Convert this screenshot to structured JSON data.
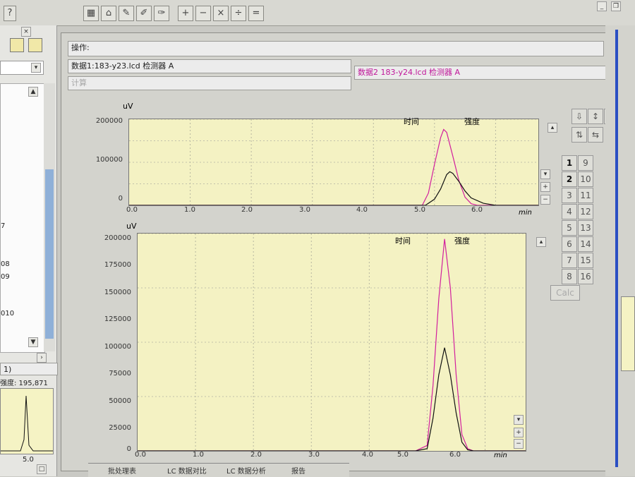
{
  "toolbar": {
    "help_icon": "?"
  },
  "left_panel": {
    "list_items": [
      "7",
      "08",
      "09",
      "010"
    ],
    "dropdown": "1)",
    "intensity": "强度: 195,871",
    "thumb_x_tick": "5.0"
  },
  "fields": {
    "operation": "操作:",
    "data1": "数据1:183-y23.lcd 检测器 A",
    "data2": "数据2 183-y24.lcd 检测器 A",
    "calc": "计算"
  },
  "plot1": {
    "y_unit": "uV",
    "x_unit": "min",
    "time_label": "时间",
    "intensity_label": "强度",
    "y_ticks": [
      "200000",
      "100000",
      "0"
    ],
    "x_ticks": [
      "0.0",
      "1.0",
      "2.0",
      "3.0",
      "4.0",
      "5.0",
      "6.0"
    ]
  },
  "plot2": {
    "y_unit": "uV",
    "x_unit": "min",
    "time_label": "时间",
    "intensity_label": "强度",
    "y_ticks": [
      "200000",
      "175000",
      "150000",
      "125000",
      "100000",
      "75000",
      "50000",
      "25000",
      "0"
    ],
    "x_ticks": [
      "0.0",
      "1.0",
      "2.0",
      "3.0",
      "4.0",
      "5.0",
      "6.0"
    ]
  },
  "right_controls": {
    "numbers_left": [
      "1",
      "2",
      "3",
      "4",
      "5",
      "6",
      "7",
      "8"
    ],
    "numbers_right": [
      "9",
      "10",
      "11",
      "12",
      "13",
      "14",
      "15",
      "16"
    ],
    "calc_button": "Calc"
  },
  "tabs": [
    "批处理表",
    "LC 数据对比",
    "LC 数据分析",
    "报告"
  ],
  "colors": {
    "series1": "#d21f9e",
    "series2": "#111111",
    "plot_bg": "#f4f2c3"
  },
  "chart_data": [
    {
      "type": "line",
      "x_range": [
        0,
        6.7
      ],
      "y_range": [
        0,
        210000
      ],
      "series": [
        {
          "x": [
            4.8,
            4.9,
            5.0,
            5.1,
            5.15,
            5.2,
            5.3,
            5.4,
            5.5,
            5.6,
            5.7
          ],
          "y": [
            0,
            30000,
            100000,
            165000,
            185000,
            178000,
            120000,
            60000,
            20000,
            4000,
            0
          ]
        },
        {
          "x": [
            4.85,
            5.0,
            5.1,
            5.2,
            5.25,
            5.3,
            5.4,
            5.5,
            5.6,
            5.8,
            6.0
          ],
          "y": [
            0,
            15000,
            40000,
            75000,
            82000,
            78000,
            58000,
            35000,
            18000,
            5000,
            0
          ]
        }
      ]
    },
    {
      "type": "line",
      "x_range": [
        0,
        6.7
      ],
      "y_range": [
        0,
        200000
      ],
      "series": [
        {
          "x": [
            4.8,
            5.0,
            5.1,
            5.2,
            5.3,
            5.4,
            5.5,
            5.6,
            5.7,
            5.8
          ],
          "y": [
            0,
            5000,
            60000,
            140000,
            195000,
            150000,
            70000,
            15000,
            2000,
            0
          ]
        },
        {
          "x": [
            4.8,
            5.0,
            5.1,
            5.2,
            5.3,
            5.4,
            5.5,
            5.6,
            5.7,
            5.8
          ],
          "y": [
            0,
            2000,
            30000,
            70000,
            95000,
            70000,
            35000,
            8000,
            1000,
            0
          ]
        }
      ]
    }
  ]
}
